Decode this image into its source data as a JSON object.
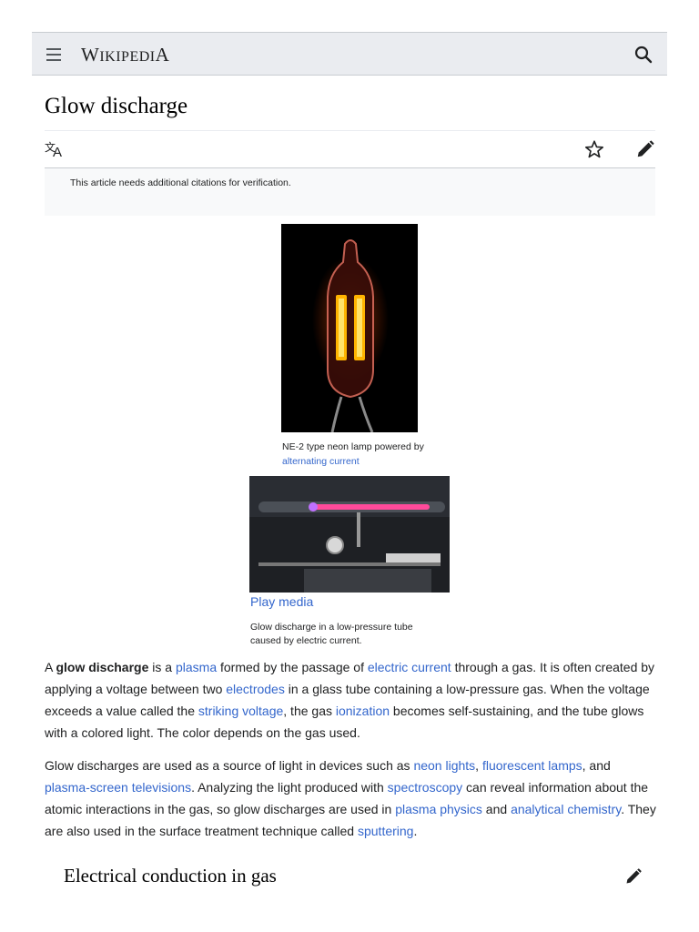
{
  "header": {
    "wordmark_first": "W",
    "wordmark_small": "IKIPEDI",
    "wordmark_last": "A"
  },
  "article": {
    "title": "Glow discharge"
  },
  "notice": {
    "text": "This article needs additional citations for verification."
  },
  "figure1": {
    "caption_prefix": "NE-2 type neon lamp powered by ",
    "caption_link": "alternating current"
  },
  "figure2": {
    "play_label": "Play media",
    "caption": "Glow discharge in a low-pressure tube caused by electric current."
  },
  "paragraph1": {
    "t1": "A ",
    "bold": "glow discharge",
    "t2": " is a ",
    "l1": "plasma",
    "t3": " formed by the passage of ",
    "l2": "electric current",
    "t4": " through a gas. It is often created by applying a voltage between two ",
    "l3": "electrodes",
    "t5": " in a glass tube containing a low-pressure gas. When the voltage exceeds a value called the ",
    "l4": "striking voltage",
    "t6": ", the gas ",
    "l5": "ionization",
    "t7": " becomes self-sustaining, and the tube glows with a colored light. The color depends on the gas used."
  },
  "paragraph2": {
    "t1": "Glow discharges are used as a source of light in devices such as ",
    "l1": "neon lights",
    "t2": ", ",
    "l2": "fluorescent lamps",
    "t3": ", and ",
    "l3": "plasma-screen televisions",
    "t4": ". Analyzing the light produced with ",
    "l4": "spectroscopy",
    "t5": " can reveal information about the atomic interactions in the gas, so glow discharges are used in ",
    "l5": "plasma physics",
    "t6": " and ",
    "l6": "analytical chemistry",
    "t7": ". They are also used in the surface treatment technique called ",
    "l7": "sputtering",
    "t8": "."
  },
  "section": {
    "heading": "Electrical conduction in gas"
  },
  "icons": {
    "menu": "menu-icon",
    "search": "search-icon",
    "language": "language-icon",
    "watch": "star-icon",
    "edit": "pencil-icon"
  },
  "colors": {
    "link": "#3366cc",
    "header_bg": "#eaecf0",
    "notice_bg": "#f8f9fa"
  }
}
